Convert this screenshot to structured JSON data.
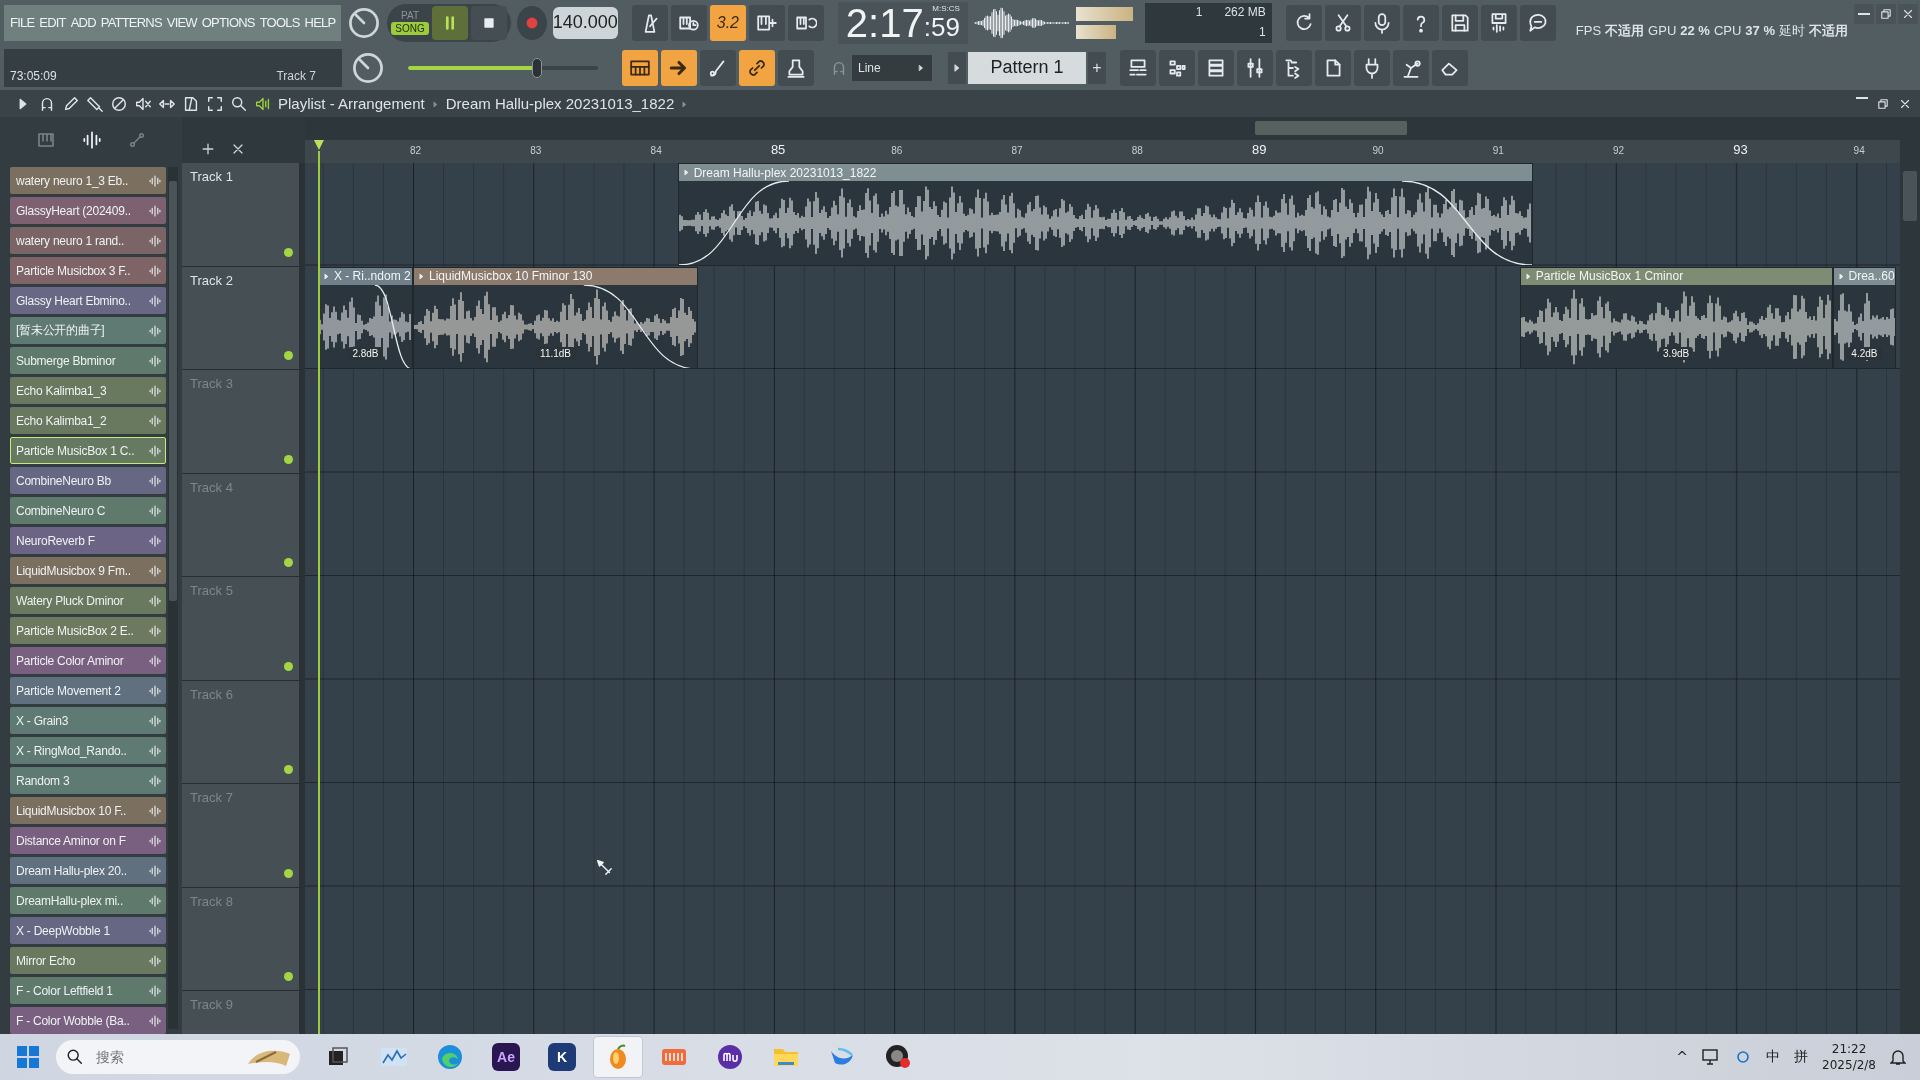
{
  "menu": [
    {
      "label": "FILE"
    },
    {
      "label": "EDIT"
    },
    {
      "label": "ADD"
    },
    {
      "label": "PATTERNS"
    },
    {
      "label": "VIEW"
    },
    {
      "label": "OPTIONS"
    },
    {
      "label": "TOOLS"
    },
    {
      "label": "HELP"
    }
  ],
  "hint_bar": {
    "position": "73:05:09",
    "target": "Track 7"
  },
  "transport": {
    "pat_label": "PAT",
    "song_label": "SONG",
    "song_mode": true,
    "playing": true
  },
  "tempo": "140.000",
  "master_volume": {
    "level": 0.68
  },
  "time": {
    "value": "2:17",
    "centiseconds": ":59",
    "format": "M:S:CS"
  },
  "record_toolbar": [
    {
      "on": false
    },
    {
      "on": false
    },
    {
      "label": "3.2",
      "on": true
    },
    {
      "on": false
    },
    {
      "on": false
    }
  ],
  "edit_toolbar": [
    {
      "on": true
    },
    {
      "on": true
    },
    {
      "on": false
    },
    {
      "on": true
    },
    {
      "on": false
    }
  ],
  "snap": "Line",
  "pattern": {
    "name": "Pattern 1",
    "add": "+"
  },
  "cpu_panel": {
    "polyphony": "1",
    "memory": "262 MB",
    "voices": "1"
  },
  "perf": [
    {
      "label": "FPS",
      "value": "不适用"
    },
    {
      "label": "GPU",
      "value": "22 %"
    },
    {
      "label": "CPU",
      "value": "37 %"
    },
    {
      "label": "延时",
      "value": "不适用"
    }
  ],
  "playlist": {
    "title": "Playlist - Arrangement",
    "clip_path": "Dream Hallu-plex 20231013_1822",
    "ruler": [
      "82",
      "83",
      "84",
      "85",
      "86",
      "87",
      "88",
      "89",
      "90",
      "91",
      "92",
      "93",
      "94"
    ],
    "tracks": [
      {
        "name": "Track 1",
        "dimmed": false,
        "clips": [
          {
            "name": "Dream Hallu-plex 20231013_1822",
            "color": "#7e8e93",
            "fade_in": true,
            "fade_out": true
          }
        ]
      },
      {
        "name": "Track 2",
        "dimmed": false,
        "clips": [
          {
            "name": "X - Ri..ndom 2",
            "color": "#6f808a",
            "gain": "2.8dB",
            "fade_in": false,
            "fade_out": true
          },
          {
            "name": "LiquidMusicbox 10 Fminor 130",
            "color": "#8c7b6c",
            "gain": "11.1dB",
            "fade_in": false,
            "fade_out": true
          },
          {
            "name": "Particle MusicBox 1 Cminor",
            "color": "#7f8c74",
            "gain": "3.9dB",
            "fade_in": false,
            "fade_out": false
          },
          {
            "name": "Drea..60",
            "color": "#7e8e93",
            "gain": "4.2dB",
            "fade_in": false,
            "fade_out": false
          }
        ]
      },
      {
        "name": "Track 3",
        "dimmed": true
      },
      {
        "name": "Track 4",
        "dimmed": true
      },
      {
        "name": "Track 5",
        "dimmed": true
      },
      {
        "name": "Track 6",
        "dimmed": true
      },
      {
        "name": "Track 7",
        "dimmed": true
      },
      {
        "name": "Track 8",
        "dimmed": true
      },
      {
        "name": "Track 9",
        "dimmed": true
      }
    ]
  },
  "browser": {
    "items": [
      {
        "name": "watery neuro 1_3 Eb..",
        "color": "#7b6f60",
        "selected": false
      },
      {
        "name": "GlassyHeart (202409..",
        "color": "#7d6170",
        "selected": false
      },
      {
        "name": "watery neuro 1 rand..",
        "color": "#7a6466",
        "selected": false
      },
      {
        "name": "Particle Musicbox 3 F..",
        "color": "#7e6466",
        "selected": false
      },
      {
        "name": "Glassy Heart Ebmino..",
        "color": "#686884",
        "selected": false
      },
      {
        "name": "[暂未公开的曲子]",
        "color": "#5f7a73",
        "selected": false
      },
      {
        "name": "Submerge Bbminor",
        "color": "#5f7a6c",
        "selected": false
      },
      {
        "name": "Echo Kalimba1_3",
        "color": "#68795f",
        "selected": false
      },
      {
        "name": "Echo Kalimba1_2",
        "color": "#68795f",
        "selected": false
      },
      {
        "name": "Particle MusicBox 1 C..",
        "color": "#667a62",
        "selected": true
      },
      {
        "name": "CombineNeuro Bb",
        "color": "#656783",
        "selected": false
      },
      {
        "name": "CombineNeuro C",
        "color": "#5f7a6c",
        "selected": false
      },
      {
        "name": "NeuroReverb F",
        "color": "#6c6485",
        "selected": false
      },
      {
        "name": "LiquidMusicbox 9 Fm..",
        "color": "#7b6f60",
        "selected": false
      },
      {
        "name": "Watery Pluck Dminor",
        "color": "#68795f",
        "selected": false
      },
      {
        "name": "Particle MusicBox 2 E..",
        "color": "#6e7a5f",
        "selected": false
      },
      {
        "name": "Particle Color Aminor",
        "color": "#7a6080",
        "selected": false
      },
      {
        "name": "Particle Movement 2",
        "color": "#61707f",
        "selected": false
      },
      {
        "name": "X - Grain3",
        "color": "#5f7a73",
        "selected": false
      },
      {
        "name": "X - RingMod_Rando..",
        "color": "#5f7a73",
        "selected": false
      },
      {
        "name": "Random 3",
        "color": "#5f7a73",
        "selected": false
      },
      {
        "name": "LiquidMusicbox 10 F..",
        "color": "#7b6f60",
        "selected": false
      },
      {
        "name": "Distance Aminor on F",
        "color": "#7a6080",
        "selected": false
      },
      {
        "name": "Dream Hallu-plex 20..",
        "color": "#61707f",
        "selected": false
      },
      {
        "name": "DreamHallu-plex mi..",
        "color": "#5f7a6c",
        "selected": false
      },
      {
        "name": "X - DeepWobble 1",
        "color": "#656783",
        "selected": false
      },
      {
        "name": "Mirror Echo",
        "color": "#68795f",
        "selected": false
      },
      {
        "name": "F - Color Leftfield 1",
        "color": "#5f7a6c",
        "selected": false
      },
      {
        "name": "F - Color Wobble (Ba..",
        "color": "#7a6080",
        "selected": false
      }
    ]
  },
  "taskbar": {
    "search_placeholder": "搜索",
    "apps": [
      {
        "selected": false
      },
      {
        "selected": false
      },
      {
        "selected": false
      },
      {
        "label": "Ae",
        "selected": false
      },
      {
        "label": "K",
        "selected": false
      },
      {
        "selected": true
      },
      {
        "selected": false
      },
      {
        "selected": false
      },
      {
        "selected": false
      },
      {
        "selected": false
      },
      {
        "selected": false
      }
    ],
    "tray_caret": "^",
    "ime": "中",
    "ime_mode": "拼",
    "time": "21:22",
    "date": "2025/2/8"
  }
}
